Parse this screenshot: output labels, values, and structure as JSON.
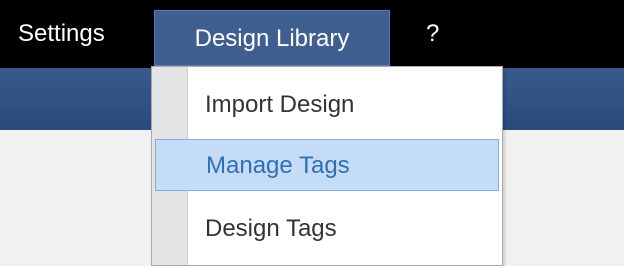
{
  "menubar": {
    "items": [
      {
        "label": "Settings"
      },
      {
        "label": "Design Library"
      },
      {
        "label": "?"
      }
    ]
  },
  "dropdown": {
    "items": [
      {
        "label": "Import Design"
      },
      {
        "label": "Manage Tags"
      },
      {
        "label": "Design Tags"
      }
    ],
    "highlighted": "Manage Tags"
  },
  "colors": {
    "menubar_bg": "#000000",
    "active_menu_bg": "#3f5f91",
    "band_bg": "#2f5183",
    "highlight_bg": "#c5dcf6",
    "highlight_text": "#2e6fb5"
  }
}
